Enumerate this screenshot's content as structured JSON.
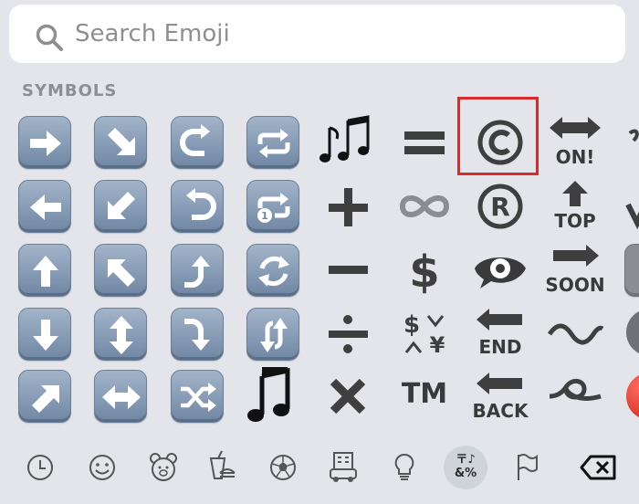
{
  "search": {
    "placeholder": "Search Emoji"
  },
  "section": {
    "title": "SYMBOLS"
  },
  "symbols": {
    "on_label": "ON!",
    "top_label": "TOP",
    "soon_label": "SOON",
    "end_label": "END",
    "back_label": "BACK",
    "tm_label": "TM",
    "yen_glyph": "$¥"
  },
  "categories": {
    "symbols_tab_top": "〒♪",
    "symbols_tab_bottom": "&%"
  },
  "colors": {
    "background": "#e3e5ea",
    "key_blue": "#7b91ad",
    "highlight": "#d92b2b",
    "symbol_gray": "#3f3f3f"
  }
}
